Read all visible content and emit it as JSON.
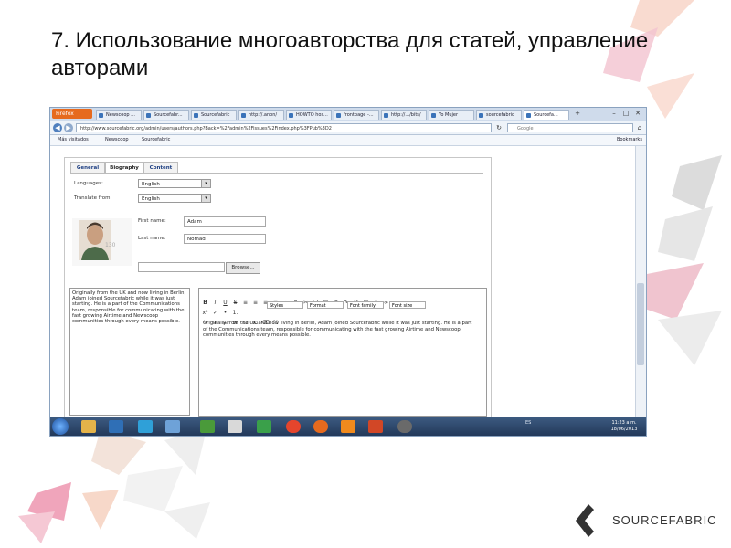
{
  "slide": {
    "title": "7. Использование многоавторства для статей, управление авторами"
  },
  "browser": {
    "firefox_label": "Firefox",
    "tabs": [
      {
        "label": "Newscoop ..."
      },
      {
        "label": "Sourcefabr..."
      },
      {
        "label": "Sourcefabric"
      },
      {
        "label": "http://.anon/"
      },
      {
        "label": "HOWTO hos..."
      },
      {
        "label": "frontpage -..."
      },
      {
        "label": "http://.../bits/"
      },
      {
        "label": "Yo Mujer"
      },
      {
        "label": "sourcefabric"
      },
      {
        "label": "Sourcefa..."
      }
    ],
    "url": "http://www.sourcefabric.org/admin/users/authors.php?Back=%2Fadmin%2Fissues%2Findex.php%3FPub%3D2",
    "search_placeholder": "Google",
    "bookmarks": [
      {
        "label": "Más visitados"
      },
      {
        "label": "Newscoop"
      },
      {
        "label": "Sourcefabric"
      }
    ],
    "bookmarks_right": "Bookmarks"
  },
  "author_form": {
    "tabs": [
      {
        "label": "General"
      },
      {
        "label": "Biography"
      },
      {
        "label": "Content"
      }
    ],
    "languages_label": "Languages:",
    "languages_value": "English",
    "translate_label": "Translate from:",
    "translate_value": "English",
    "first_name_label": "First name:",
    "first_name_value": "Adam",
    "last_name_label": "Last name:",
    "last_name_value": "Nomad",
    "image_label": "130",
    "browse_label": "Browse...",
    "bio_plain": "Originally from the UK and now living in Berlin, Adam joined Sourcefabric while it was just starting. He is a part of the Communications team, responsible for communicating with the fast growing Airtime and Newscoop communities through every means possible.",
    "editor_styles": "Styles",
    "editor_format": "Format",
    "editor_font_family": "Font family",
    "editor_font_size": "Font size",
    "editor_text": "Originally from the UK and now living in Berlin, Adam joined Sourcefabric while it was just starting. He is a part of the Communications team, responsible for communicating with the fast growing Airtime and Newscoop communities through every means possible."
  },
  "taskbar": {
    "tray_lang": "ES",
    "time": "11:23 a.m.",
    "date": "18/06/2013"
  },
  "logo": {
    "text": "SOURCEFABRIC"
  },
  "colors": {
    "accent_pink": "#e98aa6",
    "accent_orange": "#f4b69a",
    "gray_deco": "#d8d8d8",
    "firefox_orange": "#e66a1e",
    "link_blue": "#1e3f82"
  }
}
